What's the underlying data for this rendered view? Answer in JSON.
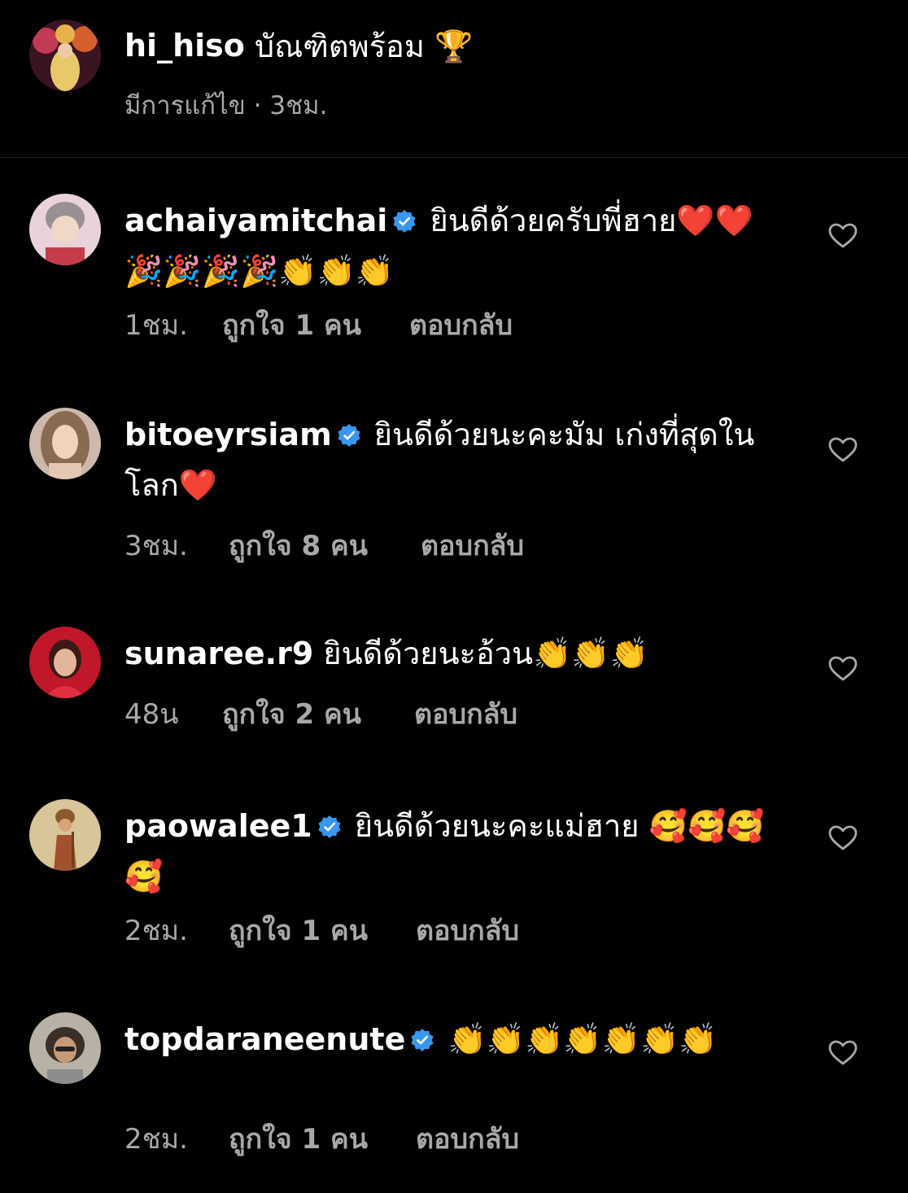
{
  "post": {
    "username": "hi_hiso",
    "caption": "บัณฑิตพร้อม 🏆",
    "edited_label": "มีการแก้ไข",
    "separator": "·",
    "time": "3ชม."
  },
  "comments": [
    {
      "username": "achaiyamitchai",
      "verified": true,
      "text": "ยินดีด้วยครับพี่ฮาย❤️❤️🎉🎉🎉🎉👏👏👏",
      "time": "1ชม.",
      "likes": "ถูกใจ 1 คน",
      "reply": "ตอบกลับ"
    },
    {
      "username": "bitoeyrsiam",
      "verified": true,
      "text": "ยินดีด้วยนะคะมัม เก่งที่สุดในโลก❤️",
      "time": "3ชม.",
      "likes": "ถูกใจ 8 คน",
      "reply": "ตอบกลับ"
    },
    {
      "username": "sunaree.r9",
      "verified": false,
      "text": "ยินดีด้วยนะอ้วน👏👏👏",
      "time": "48น",
      "likes": "ถูกใจ 2 คน",
      "reply": "ตอบกลับ"
    },
    {
      "username": "paowalee1",
      "verified": true,
      "text": "ยินดีด้วยนะคะแม่ฮาย 🥰🥰🥰🥰",
      "time": "2ชม.",
      "likes": "ถูกใจ 1 คน",
      "reply": "ตอบกลับ"
    },
    {
      "username": "topdaraneenute",
      "verified": true,
      "text": "👏👏👏👏👏👏👏",
      "time": "2ชม.",
      "likes": "ถูกใจ 1 คน",
      "reply": "ตอบกลับ"
    }
  ],
  "icons": {
    "like": "heart-outline-icon",
    "verified": "verified-badge-icon"
  },
  "colors": {
    "background": "#000000",
    "text": "#ffffff",
    "secondary_text": "#a8a8a8",
    "verified_blue": "#3897f0",
    "divider": "#262626"
  }
}
